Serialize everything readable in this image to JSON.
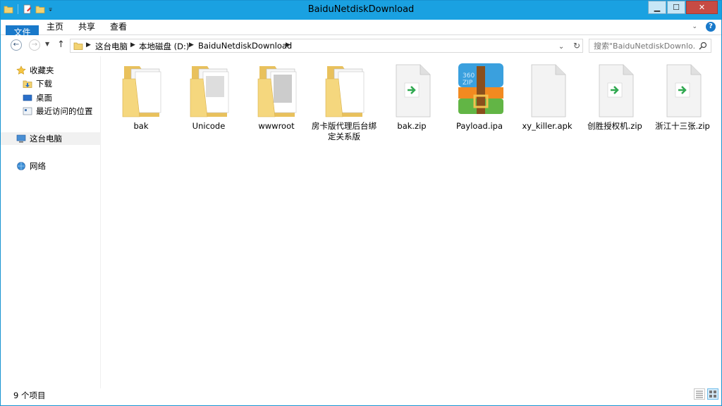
{
  "window": {
    "title": "BaiduNetdiskDownload",
    "controls": {
      "minimize": "▁",
      "maximize": "☐",
      "close": "✕"
    }
  },
  "quick_access_toolbar": {
    "icons": [
      "folder-icon",
      "properties-icon",
      "new-folder-icon",
      "dropdown-icon"
    ]
  },
  "ribbon": {
    "tabs": [
      {
        "label": "文件",
        "active": true
      },
      {
        "label": "主页"
      },
      {
        "label": "共享"
      },
      {
        "label": "查看"
      }
    ],
    "help_label": "?"
  },
  "address_bar": {
    "breadcrumbs": [
      "这台电脑",
      "本地磁盘 (D:)",
      "BaiduNetdiskDownload"
    ]
  },
  "search": {
    "placeholder": "搜索\"BaiduNetdiskDownlo..."
  },
  "nav_pane": {
    "favorites": {
      "label": "收藏夹",
      "items": [
        "下载",
        "桌面",
        "最近访问的位置"
      ]
    },
    "this_pc": {
      "label": "这台电脑",
      "selected": true
    },
    "network": {
      "label": "网络"
    }
  },
  "files": [
    {
      "name": "bak",
      "type": "folder"
    },
    {
      "name": "Unicode",
      "type": "folder"
    },
    {
      "name": "wwwroot",
      "type": "folder"
    },
    {
      "name": "房卡版代理后台绑定关系版",
      "type": "folder"
    },
    {
      "name": "bak.zip",
      "type": "zip"
    },
    {
      "name": "Payload.ipa",
      "type": "360zip"
    },
    {
      "name": "xy_killer.apk",
      "type": "file"
    },
    {
      "name": "创胜授权机.zip",
      "type": "zip"
    },
    {
      "name": "浙江十三张.zip",
      "type": "zip"
    }
  ],
  "status_bar": {
    "item_count": "9 个项目"
  },
  "colors": {
    "titlebar": "#1aa1e1",
    "file_tab": "#1979ca",
    "close_button": "#c74b44",
    "folder": "#f5d77e"
  }
}
